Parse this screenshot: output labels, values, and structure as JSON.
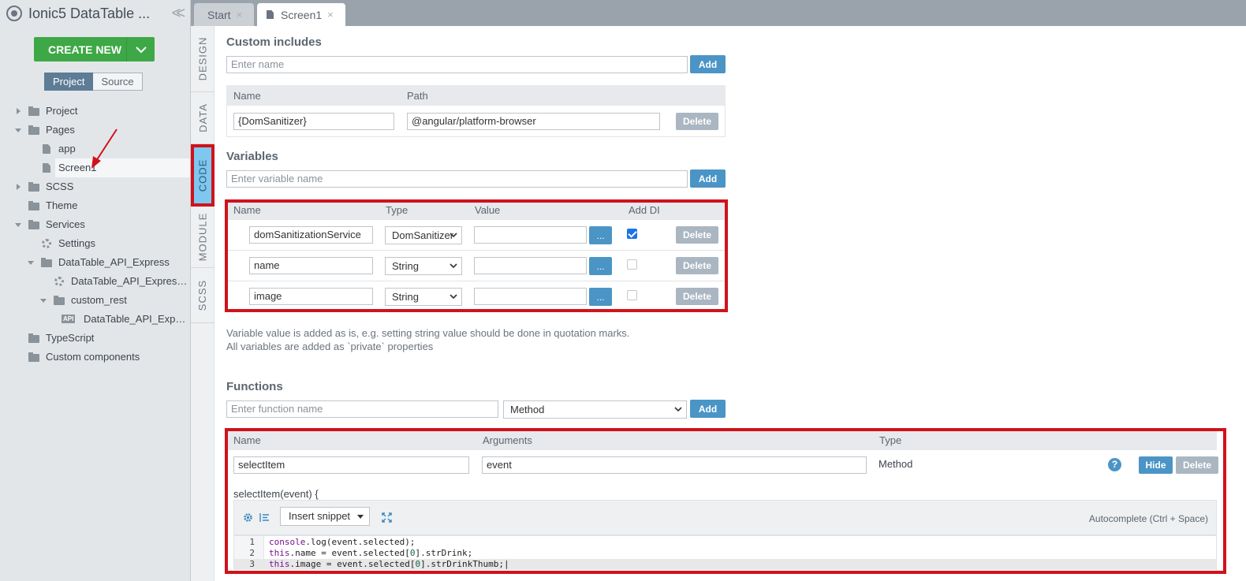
{
  "app": {
    "title": "Ionic5 DataTable ..."
  },
  "sidebar": {
    "create_label": "CREATE NEW",
    "toggle": {
      "project": "Project",
      "source": "Source"
    },
    "tree": [
      {
        "label": "Project",
        "icon": "folder-icon",
        "level": 0,
        "arrow": "right"
      },
      {
        "label": "Pages",
        "icon": "folder-icon",
        "level": 0,
        "arrow": "down"
      },
      {
        "label": "app",
        "icon": "file-icon",
        "level": 1,
        "arrow": ""
      },
      {
        "label": "Screen1",
        "icon": "file-icon",
        "level": 1,
        "arrow": "",
        "selected": true
      },
      {
        "label": "SCSS",
        "icon": "folder-icon",
        "level": 0,
        "arrow": "right"
      },
      {
        "label": "Theme",
        "icon": "folder-icon",
        "level": 0,
        "arrow": ""
      },
      {
        "label": "Services",
        "icon": "folder-icon",
        "level": 0,
        "arrow": "down"
      },
      {
        "label": "Settings",
        "icon": "gear-icon",
        "level": 1,
        "arrow": ""
      },
      {
        "label": "DataTable_API_Express",
        "icon": "folder-icon",
        "level": 1,
        "arrow": "down"
      },
      {
        "label": "DataTable_API_Express_s...",
        "icon": "gear-icon",
        "level": 2,
        "arrow": ""
      },
      {
        "label": "custom_rest",
        "icon": "folder-icon",
        "level": 2,
        "arrow": "down"
      },
      {
        "label": "DataTable_API_Expres...",
        "icon": "api-icon",
        "level": 3,
        "arrow": ""
      },
      {
        "label": "TypeScript",
        "icon": "folder-icon",
        "level": 0,
        "arrow": ""
      },
      {
        "label": "Custom components",
        "icon": "folder-icon",
        "level": 0,
        "arrow": ""
      }
    ]
  },
  "tabs": {
    "start": "Start",
    "screen1": "Screen1",
    "close": "×"
  },
  "vtabs": {
    "design": "DESIGN",
    "data": "DATA",
    "code": "CODE",
    "module": "MODULE",
    "scss": "SCSS"
  },
  "includes": {
    "title": "Custom includes",
    "placeholder": "Enter name",
    "add_label": "Add",
    "headers": {
      "name": "Name",
      "path": "Path"
    },
    "rows": [
      {
        "name": "{DomSanitizer}",
        "path": "@angular/platform-browser",
        "delete": "Delete"
      }
    ]
  },
  "variables": {
    "title": "Variables",
    "placeholder": "Enter variable name",
    "add_label": "Add",
    "headers": {
      "name": "Name",
      "type": "Type",
      "value": "Value",
      "add_di": "Add DI"
    },
    "rows": [
      {
        "name": "domSanitizationService",
        "type": "DomSanitizer",
        "value": "",
        "dots": "...",
        "add_di": true,
        "delete": "Delete"
      },
      {
        "name": "name",
        "type": "String",
        "value": "",
        "dots": "...",
        "add_di": false,
        "delete": "Delete"
      },
      {
        "name": "image",
        "type": "String",
        "value": "",
        "dots": "...",
        "add_di": false,
        "delete": "Delete"
      }
    ],
    "note_1": "Variable value is added as is, e.g. setting string value should be done in quotation marks.",
    "note_2": "All variables are added as `private` properties"
  },
  "functions": {
    "title": "Functions",
    "placeholder": "Enter function name",
    "kind_select": "Method",
    "add_label": "Add",
    "headers": {
      "name": "Name",
      "arguments": "Arguments",
      "type": "Type"
    },
    "row": {
      "name": "selectItem",
      "arguments": "event",
      "type": "Method",
      "hide": "Hide",
      "delete": "Delete"
    },
    "signature": "selectItem(event) {",
    "insert_snippet": "Insert snippet",
    "autocomplete_hint": "Autocomplete (Ctrl + Space)",
    "code_lines": [
      {
        "n": "1",
        "text": "console.log(event.selected);"
      },
      {
        "n": "2",
        "text": "this.name = event.selected[0].strDrink;"
      },
      {
        "n": "3",
        "text": "this.image = event.selected[0].strDrinkThumb;"
      }
    ]
  },
  "colors": {
    "accent": "#4b95c6",
    "create": "#3ea846",
    "highlight": "#d0121b",
    "code_tab": "#7fc7ee"
  }
}
